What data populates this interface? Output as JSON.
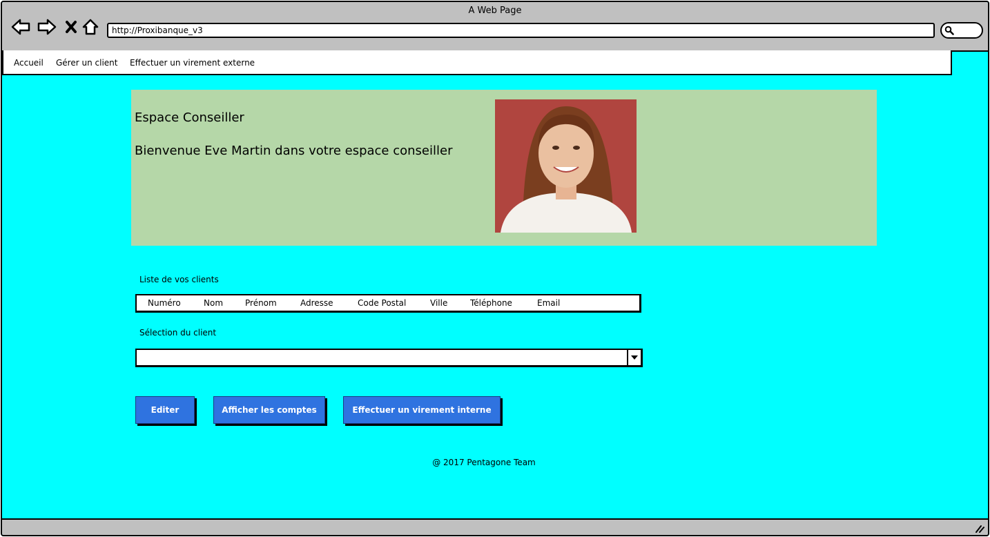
{
  "window": {
    "title": "A Web Page",
    "url": "http://Proxibanque_v3"
  },
  "menu": {
    "items": [
      {
        "label": "Accueil"
      },
      {
        "label": "Gérer un client"
      },
      {
        "label": "Effectuer un virement externe"
      }
    ]
  },
  "banner": {
    "title": "Espace Conseiller",
    "welcome": "Bienvenue Eve Martin dans votre espace conseiller",
    "colors": {
      "background": "#b5d7a8"
    }
  },
  "clients": {
    "label": "Liste de vos clients",
    "columns": [
      "Numéro",
      "Nom",
      "Prénom",
      "Adresse",
      "Code Postal",
      "Ville",
      "Téléphone",
      "Email"
    ]
  },
  "selection": {
    "label": "Sélection du client",
    "value": ""
  },
  "actions": {
    "edit_label": "Editer",
    "accounts_label": "Afficher les comptes",
    "transfer_label": "Effectuer un virement interne"
  },
  "footer": {
    "text": "@ 2017 Pentagone Team"
  },
  "theme": {
    "page_bg": "#00ffff",
    "button_bg": "#2f73e0",
    "chrome_bg": "#c0c0c0"
  }
}
